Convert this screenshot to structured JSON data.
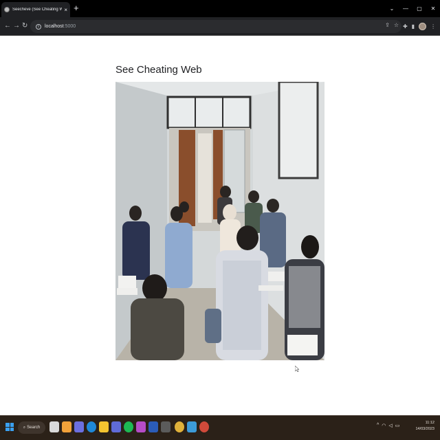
{
  "browser": {
    "tab": {
      "title": "Seecheve (See Cheating Web)",
      "close_glyph": "×",
      "favicon": "globe-icon"
    },
    "new_tab_glyph": "+",
    "window_controls": {
      "chevron": "⌄",
      "minimize": "—",
      "maximize": "▢",
      "close": "✕"
    },
    "toolbar": {
      "back": "←",
      "forward": "→",
      "reload": "↻",
      "info_glyph": "i",
      "url_host": "localhost",
      "url_port": ":5000",
      "share_glyph": "⇪",
      "star_glyph": "☆",
      "extensions_glyph": "✚",
      "sidepanel_glyph": "▮",
      "menu_glyph": "⋮"
    }
  },
  "page": {
    "heading": "See Cheating Web",
    "camera_feed": "classroom-camera-stream"
  },
  "taskbar": {
    "search_glyph": "⌕",
    "search_label": "Search",
    "tray": {
      "chevron": "^",
      "wifi": "◠",
      "volume": "◁",
      "battery": "▭"
    },
    "clock": {
      "time": "11:12",
      "date": "14/03/2023"
    },
    "colors": {
      "background": "#2b2118",
      "accent": "#3aa0f0"
    }
  }
}
